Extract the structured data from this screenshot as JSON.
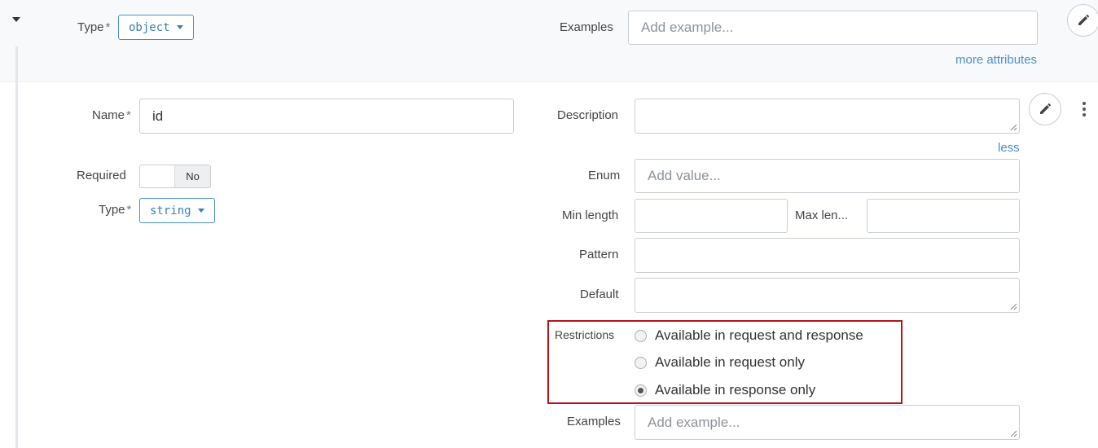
{
  "header": {
    "type_label": "Type",
    "required_mark": "*",
    "type_value": "object",
    "examples_label": "Examples",
    "examples_placeholder": "Add example...",
    "more_attributes_link": "more attributes"
  },
  "property": {
    "name_label": "Name",
    "name_value": "id",
    "required_label": "Required",
    "required_toggle_value": "No",
    "type_label": "Type",
    "type_value": "string",
    "description_label": "Description",
    "less_link": "less",
    "enum_label": "Enum",
    "enum_placeholder": "Add value...",
    "min_length_label": "Min length",
    "max_length_label": "Max len...",
    "pattern_label": "Pattern",
    "default_label": "Default",
    "restrictions_label": "Restrictions",
    "restrictions_options": [
      {
        "label": "Available in request and response",
        "checked": false
      },
      {
        "label": "Available in request only",
        "checked": false
      },
      {
        "label": "Available in response only",
        "checked": true
      }
    ],
    "examples_label": "Examples",
    "examples_placeholder": "Add example..."
  },
  "icons": {
    "collapse": "caret-down-icon",
    "edit": "pencil-icon",
    "menu": "kebab-menu-icon"
  },
  "colors": {
    "accent": "#4a90c8",
    "highlight_border": "#b1161c"
  }
}
